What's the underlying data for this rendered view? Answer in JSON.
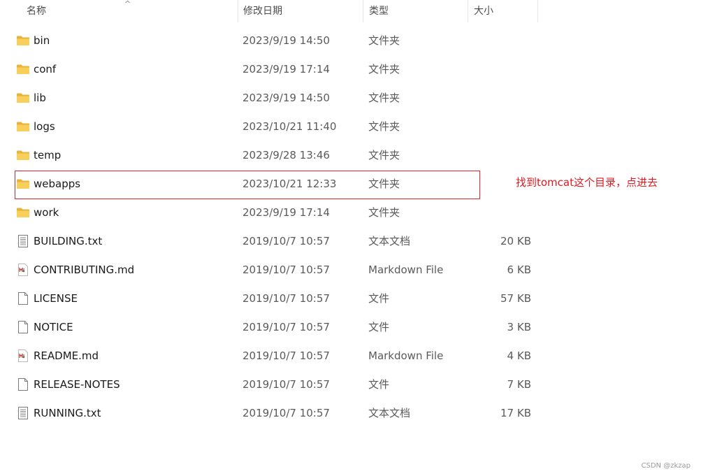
{
  "columns": {
    "name": "名称",
    "date": "修改日期",
    "type": "类型",
    "size": "大小"
  },
  "sort_indicator": "^",
  "files": [
    {
      "name": "bin",
      "date": "2023/9/19 14:50",
      "type": "文件夹",
      "size": "",
      "icon": "folder-icon"
    },
    {
      "name": "conf",
      "date": "2023/9/19 17:14",
      "type": "文件夹",
      "size": "",
      "icon": "folder-icon"
    },
    {
      "name": "lib",
      "date": "2023/9/19 14:50",
      "type": "文件夹",
      "size": "",
      "icon": "folder-icon"
    },
    {
      "name": "logs",
      "date": "2023/10/21 11:40",
      "type": "文件夹",
      "size": "",
      "icon": "folder-icon"
    },
    {
      "name": "temp",
      "date": "2023/9/28 13:46",
      "type": "文件夹",
      "size": "",
      "icon": "folder-icon"
    },
    {
      "name": "webapps",
      "date": "2023/10/21 12:33",
      "type": "文件夹",
      "size": "",
      "icon": "folder-icon"
    },
    {
      "name": "work",
      "date": "2023/9/19 17:14",
      "type": "文件夹",
      "size": "",
      "icon": "folder-icon"
    },
    {
      "name": "BUILDING.txt",
      "date": "2019/10/7 10:57",
      "type": "文本文档",
      "size": "20 KB",
      "icon": "text-document-icon"
    },
    {
      "name": "CONTRIBUTING.md",
      "date": "2019/10/7 10:57",
      "type": "Markdown File",
      "size": "6 KB",
      "icon": "markdown-file-icon"
    },
    {
      "name": "LICENSE",
      "date": "2019/10/7 10:57",
      "type": "文件",
      "size": "57 KB",
      "icon": "blank-file-icon"
    },
    {
      "name": "NOTICE",
      "date": "2019/10/7 10:57",
      "type": "文件",
      "size": "3 KB",
      "icon": "blank-file-icon"
    },
    {
      "name": "README.md",
      "date": "2019/10/7 10:57",
      "type": "Markdown File",
      "size": "4 KB",
      "icon": "markdown-file-icon"
    },
    {
      "name": "RELEASE-NOTES",
      "date": "2019/10/7 10:57",
      "type": "文件",
      "size": "7 KB",
      "icon": "blank-file-icon"
    },
    {
      "name": "RUNNING.txt",
      "date": "2019/10/7 10:57",
      "type": "文本文档",
      "size": "17 KB",
      "icon": "text-document-icon"
    }
  ],
  "annotation": {
    "text": "找到tomcat这个目录，点进去",
    "color": "#e0191f"
  },
  "watermark": "CSDN @zkzap",
  "colors": {
    "folder": "#f8cf5a",
    "folder_dark": "#e8b33a",
    "highlight_border": "#d9262c"
  }
}
